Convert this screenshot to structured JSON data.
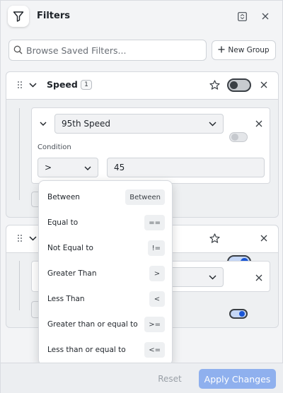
{
  "header": {
    "title": "Filters"
  },
  "search": {
    "placeholder": "Browse Saved Filters..."
  },
  "new_group": {
    "label": "New Group"
  },
  "groups": [
    {
      "name": "Speed",
      "count": "1",
      "enabled": false,
      "filter": {
        "field": "95th Speed",
        "enabled": false,
        "condition_label": "Condition",
        "operator": ">",
        "value": "45"
      }
    },
    {
      "enabled": true,
      "filter": {
        "enabled": true
      }
    }
  ],
  "operator_menu": [
    {
      "label": "Between",
      "symbol": "Between"
    },
    {
      "label": "Equal to",
      "symbol": "=="
    },
    {
      "label": "Not Equal to",
      "symbol": "!="
    },
    {
      "label": "Greater Than",
      "symbol": ">"
    },
    {
      "label": "Less Than",
      "symbol": "<"
    },
    {
      "label": "Greater than or equal to",
      "symbol": ">="
    },
    {
      "label": "Less than or equal to",
      "symbol": "<="
    }
  ],
  "footer": {
    "reset_label": "Reset",
    "apply_label": "Apply Changes"
  },
  "colors": {
    "accent": "#1a56d6",
    "apply_button": "#8fb0ee"
  }
}
